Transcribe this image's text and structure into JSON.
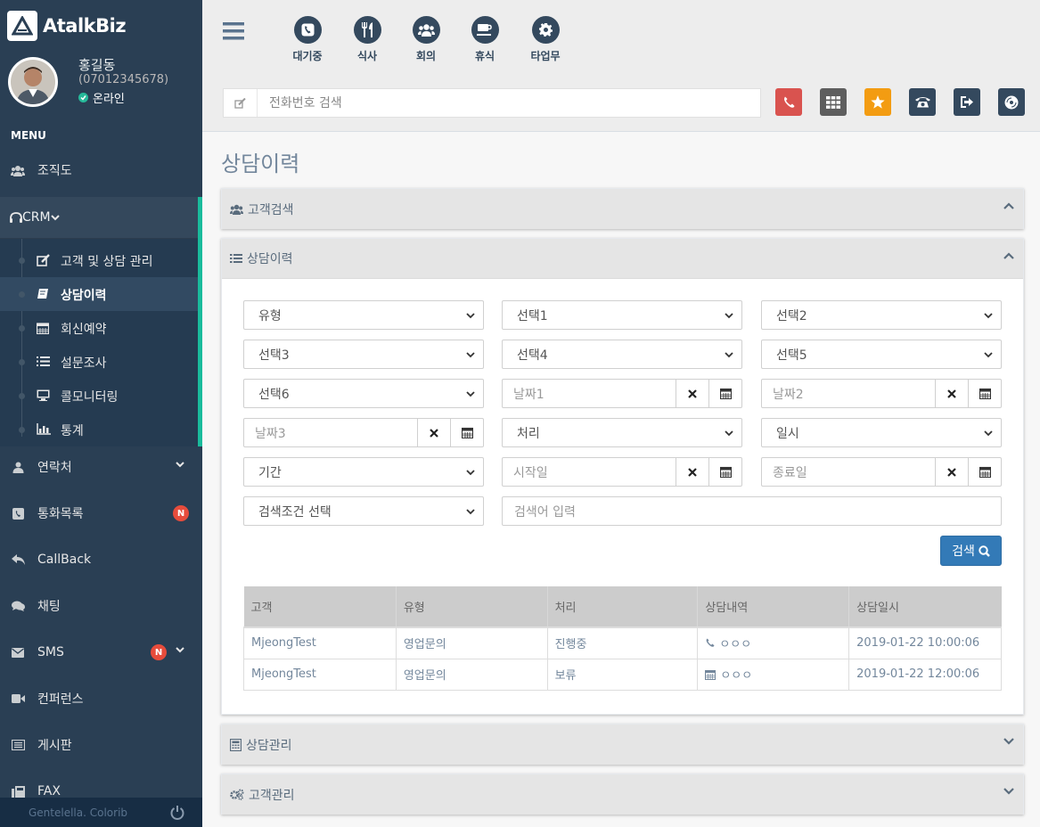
{
  "brand": {
    "name": "AtalkBiz"
  },
  "profile": {
    "name": "홍길동",
    "phone": "(07012345678)",
    "status": "온라인"
  },
  "sidebar": {
    "menu_title": "MENU",
    "items": [
      {
        "label": "조직도",
        "icon": "users-icon"
      },
      {
        "label": "CRM",
        "icon": "headset-icon"
      },
      {
        "label": "연락처",
        "icon": "user-icon"
      },
      {
        "label": "통화목록",
        "icon": "phone-square-icon",
        "badge": "N"
      },
      {
        "label": "CallBack",
        "icon": "reply-icon"
      },
      {
        "label": "채팅",
        "icon": "comments-icon"
      },
      {
        "label": "SMS",
        "icon": "envelope-icon",
        "badge": "N"
      },
      {
        "label": "컨퍼런스",
        "icon": "video-icon"
      },
      {
        "label": "게시판",
        "icon": "list-alt-icon"
      },
      {
        "label": "FAX",
        "icon": "fax-icon"
      }
    ],
    "crm_children": [
      {
        "label": "고객 및 상담 관리",
        "icon": "edit-icon"
      },
      {
        "label": "상담이력",
        "icon": "book-icon",
        "active": true
      },
      {
        "label": "회신예약",
        "icon": "calendar-icon"
      },
      {
        "label": "설문조사",
        "icon": "list-ol-icon"
      },
      {
        "label": "콜모니터링",
        "icon": "desktop-icon"
      },
      {
        "label": "통계",
        "icon": "bar-chart-icon"
      }
    ],
    "footer": "Gentelella. Colorib"
  },
  "topbar": {
    "statuses": [
      {
        "label": "대기중",
        "icon": "phone-icon"
      },
      {
        "label": "식사",
        "icon": "cutlery-icon"
      },
      {
        "label": "회의",
        "icon": "users-icon"
      },
      {
        "label": "휴식",
        "icon": "coffee-icon"
      },
      {
        "label": "타업무",
        "icon": "gear-icon"
      }
    ],
    "phone_search_placeholder": "전화번호 검색",
    "action_colors": [
      "#D9534F",
      "#5E5E5E",
      "#F39C12",
      "#34495E",
      "#34495E",
      "#34495E"
    ]
  },
  "page": {
    "title": "상담이력"
  },
  "panels": {
    "customer_search": "고객검색",
    "history": "상담이력",
    "consult_mgmt": "상담관리",
    "customer_mgmt": "고객관리"
  },
  "filters": {
    "type": "유형",
    "sel1": "선택1",
    "sel2": "선택2",
    "sel3": "선택3",
    "sel4": "선택4",
    "sel5": "선택5",
    "sel6": "선택6",
    "date1": "날짜1",
    "date2": "날짜2",
    "date3": "날짜3",
    "process": "처리",
    "datetime": "일시",
    "period": "기간",
    "start": "시작일",
    "end": "종료일",
    "condition": "검색조건 선택",
    "keyword_placeholder": "검색어 입력",
    "search_button": "검색"
  },
  "table": {
    "headers": [
      "고객",
      "유형",
      "처리",
      "상담내역",
      "상담일시"
    ],
    "rows": [
      {
        "customer": "MjeongTest",
        "type": "영업문의",
        "status": "진행중",
        "detail_icon": "phone-icon",
        "detail": "ㅇㅇㅇ",
        "datetime": "2019-01-22 10:00:06"
      },
      {
        "customer": "MjeongTest",
        "type": "영업문의",
        "status": "보류",
        "detail_icon": "calendar-icon",
        "detail": "ㅇㅇㅇ",
        "datetime": "2019-01-22 12:00:06"
      }
    ]
  },
  "colors": {
    "sidebar": "#2A3F54",
    "accent": "#1ABB9C",
    "primary": "#337AB7",
    "online": "#26B99A",
    "badge": "#E74C3C"
  }
}
